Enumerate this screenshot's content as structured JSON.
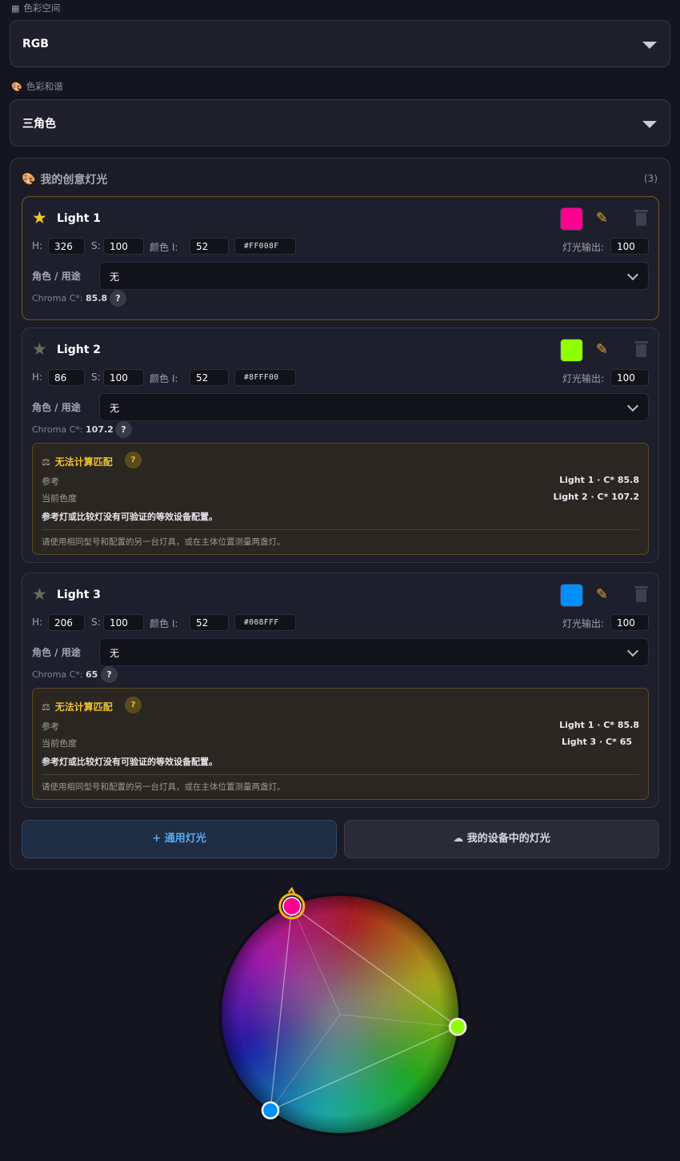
{
  "color_space": {
    "label": "色彩空间",
    "value": "RGB"
  },
  "harmony": {
    "label": "色彩和谐",
    "value": "三角色"
  },
  "panel": {
    "title": "我的创意灯光",
    "count": "(3)"
  },
  "field_labels": {
    "h": "H:",
    "s": "S:",
    "i": "颜色 I:",
    "output": "灯光输出:",
    "role": "角色 / 用途",
    "chroma": "Chroma C*:"
  },
  "lights": [
    {
      "name": "Light 1",
      "h": "326",
      "s": "100",
      "i": "52",
      "hex": "#FF008F",
      "output": "100",
      "role": "无",
      "chroma": "85.8",
      "swatch": "#ff008f",
      "selected": true
    },
    {
      "name": "Light 2",
      "h": "86",
      "s": "100",
      "i": "52",
      "hex": "#8FFF00",
      "output": "100",
      "role": "无",
      "chroma": "107.2",
      "swatch": "#8fff00",
      "selected": false,
      "warning": {
        "title": "无法计算匹配",
        "ref_label": "参考",
        "cur_label": "当前色度",
        "ref_value": "Light 1 · C* 85.8",
        "cur_value": "Light 2 · C* 107.2",
        "note": "参考灯或比较灯没有可验证的等效设备配置。",
        "hint": "请使用相同型号和配置的另一台灯具，或在主体位置测量两盏灯。"
      }
    },
    {
      "name": "Light 3",
      "h": "206",
      "s": "100",
      "i": "52",
      "hex": "#008FFF",
      "output": "100",
      "role": "无",
      "chroma": "65",
      "swatch": "#008fff",
      "selected": false,
      "warning": {
        "title": "无法计算匹配",
        "ref_label": "参考",
        "cur_label": "当前色度",
        "ref_value": "Light 1 · C* 85.8",
        "cur_value": "Light 3 · C* 65",
        "note": "参考灯或比较灯没有可验证的等效设备配置。",
        "hint": "请使用相同型号和配置的另一台灯具，或在主体位置测量两盏灯。"
      }
    }
  ],
  "buttons": {
    "add": "+ 通用灯光",
    "device": "我的设备中的灯光"
  },
  "help_glyph": "?",
  "icons": {
    "star": "star-icon",
    "edit": "pencil-icon",
    "delete": "trash-icon",
    "palette": "palette-icon",
    "cloud": "cloud-icon",
    "grid": "grid-icon",
    "scale": "scale-icon"
  },
  "wheel": {
    "harmony": "triadic",
    "hues": [
      326,
      86,
      206
    ],
    "colors": [
      "#ff008f",
      "#8fff00",
      "#008fff"
    ]
  }
}
